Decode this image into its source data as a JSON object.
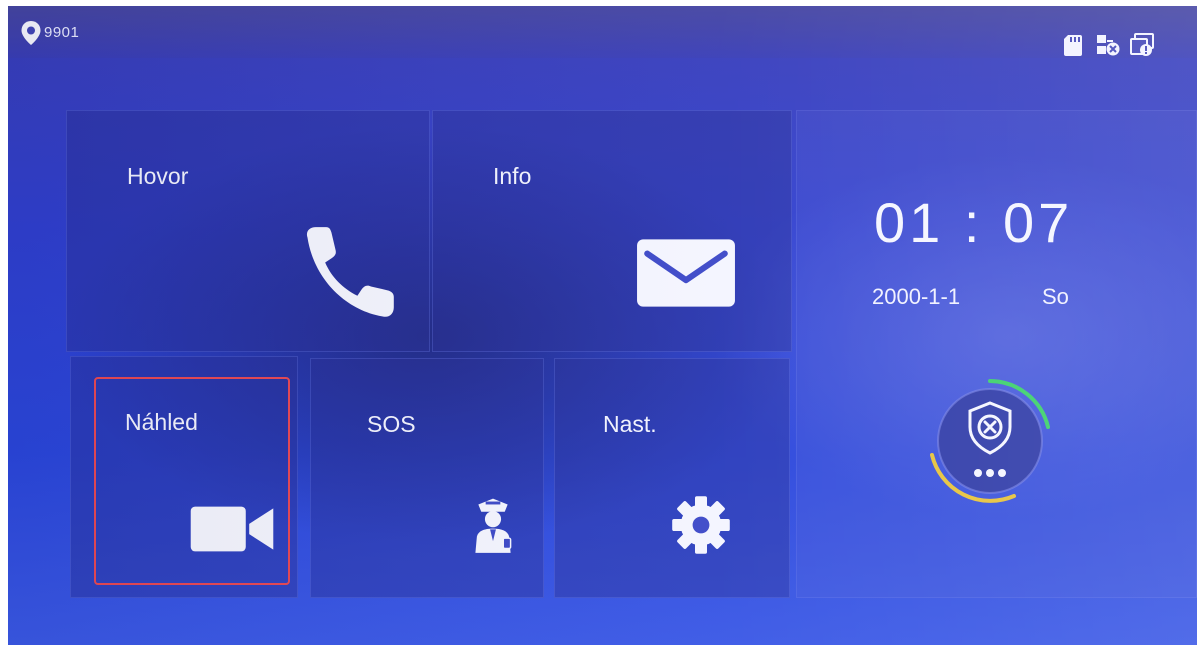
{
  "status_bar": {
    "location_icon": "location-pin-icon",
    "device_id": "9901",
    "icons": [
      "sd-card-icon",
      "network-error-icon",
      "device-alert-icon"
    ]
  },
  "tiles": {
    "call": {
      "label": "Hovor",
      "icon": "phone-icon"
    },
    "info": {
      "label": "Info",
      "icon": "envelope-icon"
    },
    "preview": {
      "label": "Náhled",
      "icon": "video-camera-icon"
    },
    "sos": {
      "label": "SOS",
      "icon": "guard-icon"
    },
    "settings": {
      "label": "Nast.",
      "icon": "gear-icon"
    }
  },
  "clock": {
    "time": "01 : 07",
    "date": "2000-1-1",
    "weekday": "So"
  },
  "arm_status": {
    "icon": "shield-disarmed-icon",
    "more_icon": "more-dots-icon"
  },
  "colors": {
    "accent_selected": "#e84855",
    "ring_green": "#3ad06a",
    "ring_yellow": "#e6c23a"
  }
}
